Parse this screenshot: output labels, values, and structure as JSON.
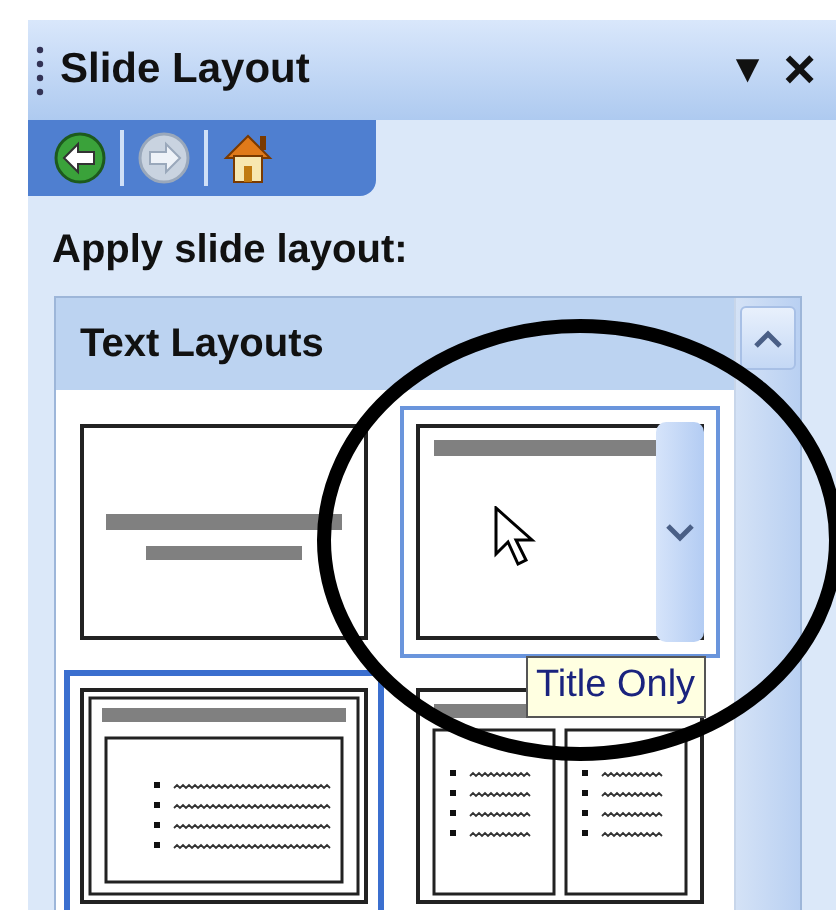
{
  "task_pane": {
    "title": "Slide Layout",
    "menu_glyph": "▼",
    "close_glyph": "×"
  },
  "nav_buttons": [
    {
      "kind": "back",
      "disabled": false
    },
    {
      "kind": "forward",
      "disabled": true
    },
    {
      "kind": "home",
      "disabled": false
    }
  ],
  "heading": "Apply slide layout:",
  "section": {
    "title": "Text Layouts"
  },
  "layouts": [
    {
      "kind": "title-slide",
      "selected": false,
      "hovered": false
    },
    {
      "kind": "title-only",
      "selected": false,
      "hovered": true
    },
    {
      "kind": "title-and-text",
      "selected": true,
      "hovered": false
    },
    {
      "kind": "two-column",
      "selected": false,
      "hovered": false
    }
  ],
  "tooltip": "Title Only"
}
